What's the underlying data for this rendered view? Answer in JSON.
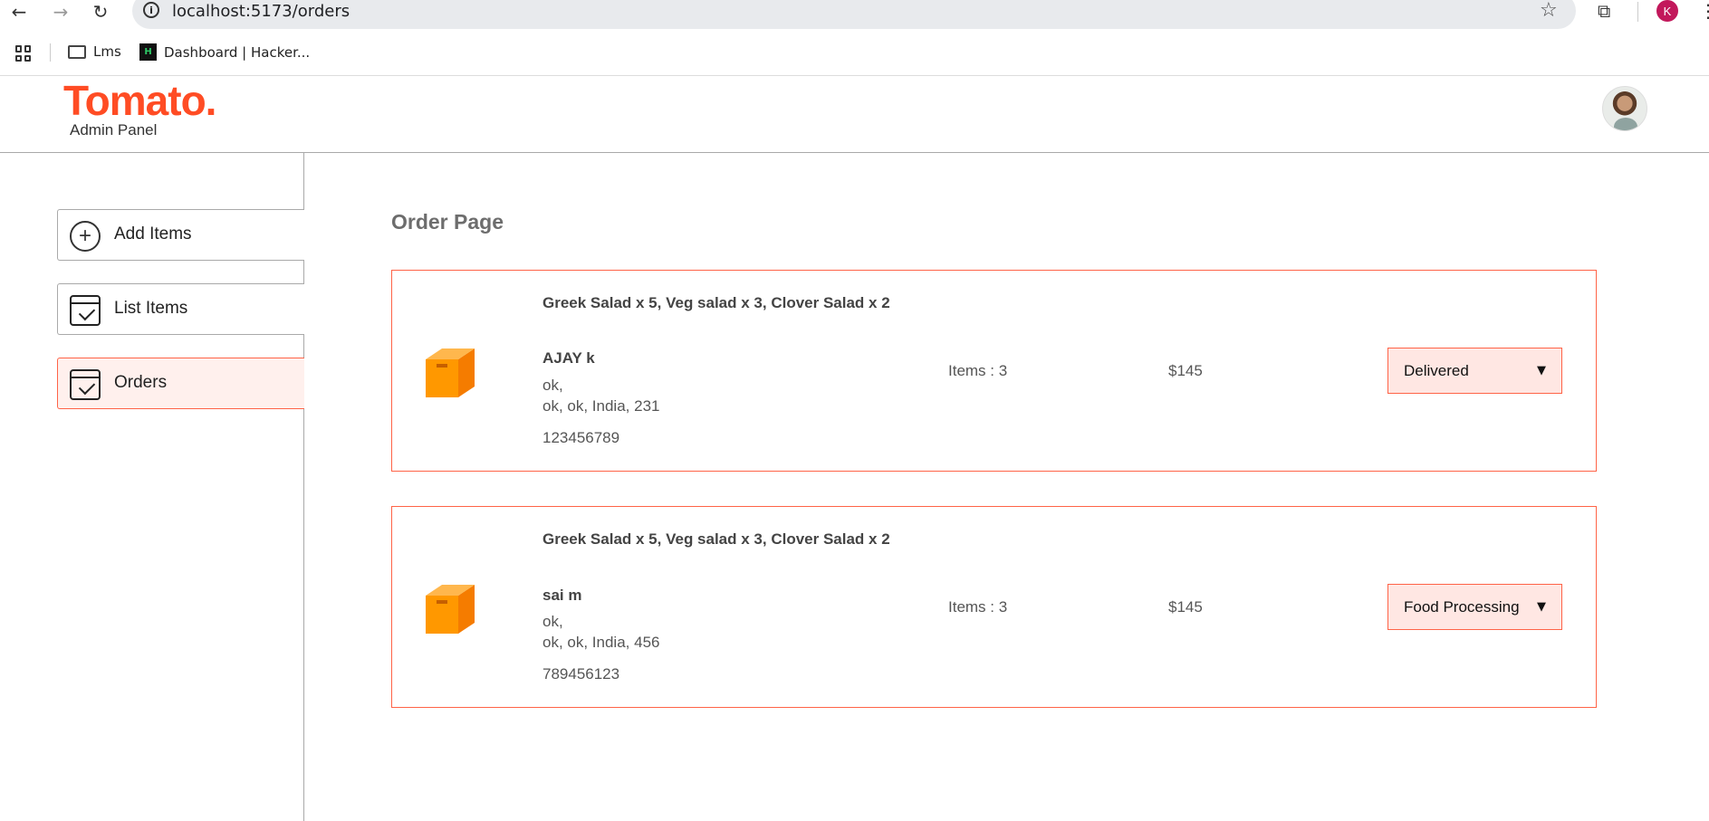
{
  "browser": {
    "url_host": "localhost",
    "url_path": ":5173/orders",
    "back_glyph": "←",
    "forward_glyph": "→",
    "reload_glyph": "↻",
    "info_glyph": "i",
    "star_glyph": "☆",
    "ext_glyph": "⧉",
    "profile_initial": "K",
    "menu_glyph": "⋮",
    "bookmarks": [
      {
        "label": "Lms",
        "icon": "folder-icon"
      },
      {
        "label": "Dashboard | Hacker...",
        "icon": "hackerrank-icon",
        "icon_text": "H"
      }
    ]
  },
  "navbar": {
    "logo": "Tomato.",
    "subtitle": "Admin Panel",
    "logo_color": "#ff4c24"
  },
  "sidebar": {
    "items": [
      {
        "label": "Add Items",
        "icon": "add-circle-icon",
        "icon_text": "+"
      },
      {
        "label": "List Items",
        "icon": "calendar-check-icon"
      },
      {
        "label": "Orders",
        "icon": "calendar-check-icon",
        "active": true
      }
    ],
    "accent": "#ff6347"
  },
  "main": {
    "title": "Order Page",
    "orders": [
      {
        "items": "Greek Salad x 5, Veg salad x 3, Clover Salad x 2",
        "name": "AJAY k",
        "address_line1": "ok,",
        "address_line2": "ok, ok, India, 231",
        "phone": "123456789",
        "count": "Items : 3",
        "amount": "$145",
        "status": "Delivered"
      },
      {
        "items": "Greek Salad x 5, Veg salad x 3, Clover Salad x 2",
        "name": "sai m",
        "address_line1": "ok,",
        "address_line2": "ok, ok, India, 456",
        "phone": "789456123",
        "count": "Items : 3",
        "amount": "$145",
        "status": "Food Processing"
      }
    ]
  }
}
